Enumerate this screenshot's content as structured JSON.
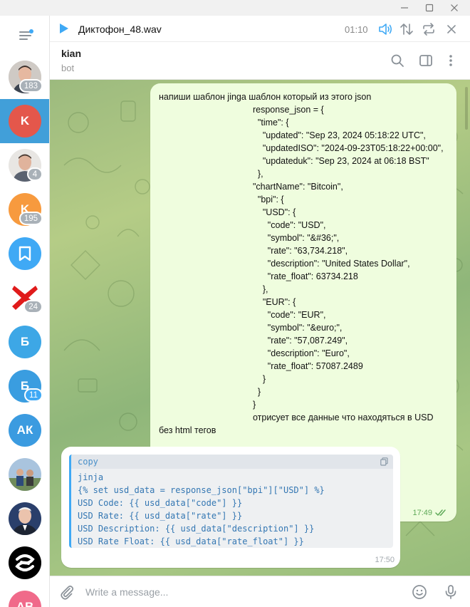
{
  "window": {
    "minimize_icon": "minimize-icon",
    "maximize_icon": "maximize-icon",
    "close_icon": "close-icon"
  },
  "sidebar": {
    "menu_icon": "hamburger-menu-icon",
    "chats": [
      {
        "name": "chat-1",
        "avatar_text": "",
        "avatar_kind": "photo-man",
        "badge": "183",
        "badge_color": "grey",
        "active": false
      },
      {
        "name": "kian",
        "avatar_text": "K",
        "avatar_color": "#e4574b",
        "badge": "",
        "active": true
      },
      {
        "name": "chat-3",
        "avatar_text": "",
        "avatar_kind": "photo-man",
        "badge": "4",
        "badge_color": "grey",
        "active": false
      },
      {
        "name": "chat-4",
        "avatar_text": "K",
        "avatar_color": "#f79a3e",
        "badge": "195",
        "badge_color": "grey",
        "active": false
      },
      {
        "name": "saved-messages",
        "avatar_text": "",
        "avatar_kind": "bookmark",
        "avatar_color": "#3fa9f5",
        "badge": "",
        "active": false
      },
      {
        "name": "chat-6",
        "avatar_text": "",
        "avatar_kind": "red-cross",
        "badge": "24",
        "badge_color": "grey",
        "active": false
      },
      {
        "name": "chat-7",
        "avatar_text": "Б",
        "avatar_color": "#3da7e6",
        "badge": "",
        "active": false
      },
      {
        "name": "chat-8",
        "avatar_text": "Б",
        "avatar_color": "#3a9de0",
        "badge": "11",
        "badge_color": "blue",
        "active": false
      },
      {
        "name": "chat-9",
        "avatar_text": "АК",
        "avatar_color": "#3b9be0",
        "badge": "",
        "active": false
      },
      {
        "name": "chat-10",
        "avatar_text": "",
        "avatar_kind": "photo-group",
        "badge": "",
        "active": false
      },
      {
        "name": "chat-11",
        "avatar_text": "",
        "avatar_kind": "photo-president",
        "badge": "",
        "active": false
      },
      {
        "name": "chat-12",
        "avatar_text": "",
        "avatar_kind": "logo",
        "badge": "",
        "active": false
      },
      {
        "name": "chat-13",
        "avatar_text": "АВ",
        "avatar_color": "#f06a8a",
        "badge": "",
        "active": false
      }
    ]
  },
  "player": {
    "title": "Диктофон_48.wav",
    "time": "01:10",
    "icons": [
      "play-icon",
      "volume-icon",
      "playback-order-icon",
      "repeat-icon",
      "close-icon"
    ]
  },
  "chat_header": {
    "name": "kian",
    "status": "bot",
    "icons": [
      "search-icon",
      "sidebar-toggle-icon",
      "more-vertical-icon"
    ]
  },
  "messages": {
    "outgoing": {
      "text": "напиши шаблон jinga шаблон который из этого json\n                                      response_json = {\n                                        \"time\": {\n                                          \"updated\": \"Sep 23, 2024 05:18:22 UTC\",\n                                          \"updatedISO\": \"2024-09-23T05:18:22+00:00\",\n                                          \"updateduk\": \"Sep 23, 2024 at 06:18 BST\"\n                                        },\n                                      \"chartName\": \"Bitcoin\",\n                                        \"bpi\": {\n                                          \"USD\": {\n                                            \"code\": \"USD\",\n                                            \"symbol\": \"&#36;\",\n                                            \"rate\": \"63,734.218\",\n                                            \"description\": \"United States Dollar\",\n                                            \"rate_float\": 63734.218\n                                          },\n                                          \"EUR\": {\n                                            \"code\": \"EUR\",\n                                            \"symbol\": \"&euro;\",\n                                            \"rate\": \"57,087.249\",\n                                            \"description\": \"Euro\",\n                                            \"rate_float\": 57087.2489\n                                          }\n                                        }\n                                      }\n                                      отрисует все данные что находяться в USD\nбез html тегов",
      "time": "17:49",
      "status_icon": "double-check-icon"
    },
    "incoming": {
      "code_header": "copy",
      "code": "jinja\n{% set usd_data = response_json[\"bpi\"][\"USD\"] %}\nUSD Code: {{ usd_data[\"code\"] }}\nUSD Rate: {{ usd_data[\"rate\"] }}\nUSD Description: {{ usd_data[\"description\"] }}\nUSD Rate Float: {{ usd_data[\"rate_float\"] }}",
      "time": "17:50"
    }
  },
  "composer": {
    "placeholder": "Write a message...",
    "icons": [
      "attach-icon",
      "emoji-icon",
      "microphone-icon"
    ]
  },
  "colors": {
    "accent": "#3fa9f5",
    "outgoing_bubble": "#effdde",
    "active_chat": "#419fd9"
  }
}
